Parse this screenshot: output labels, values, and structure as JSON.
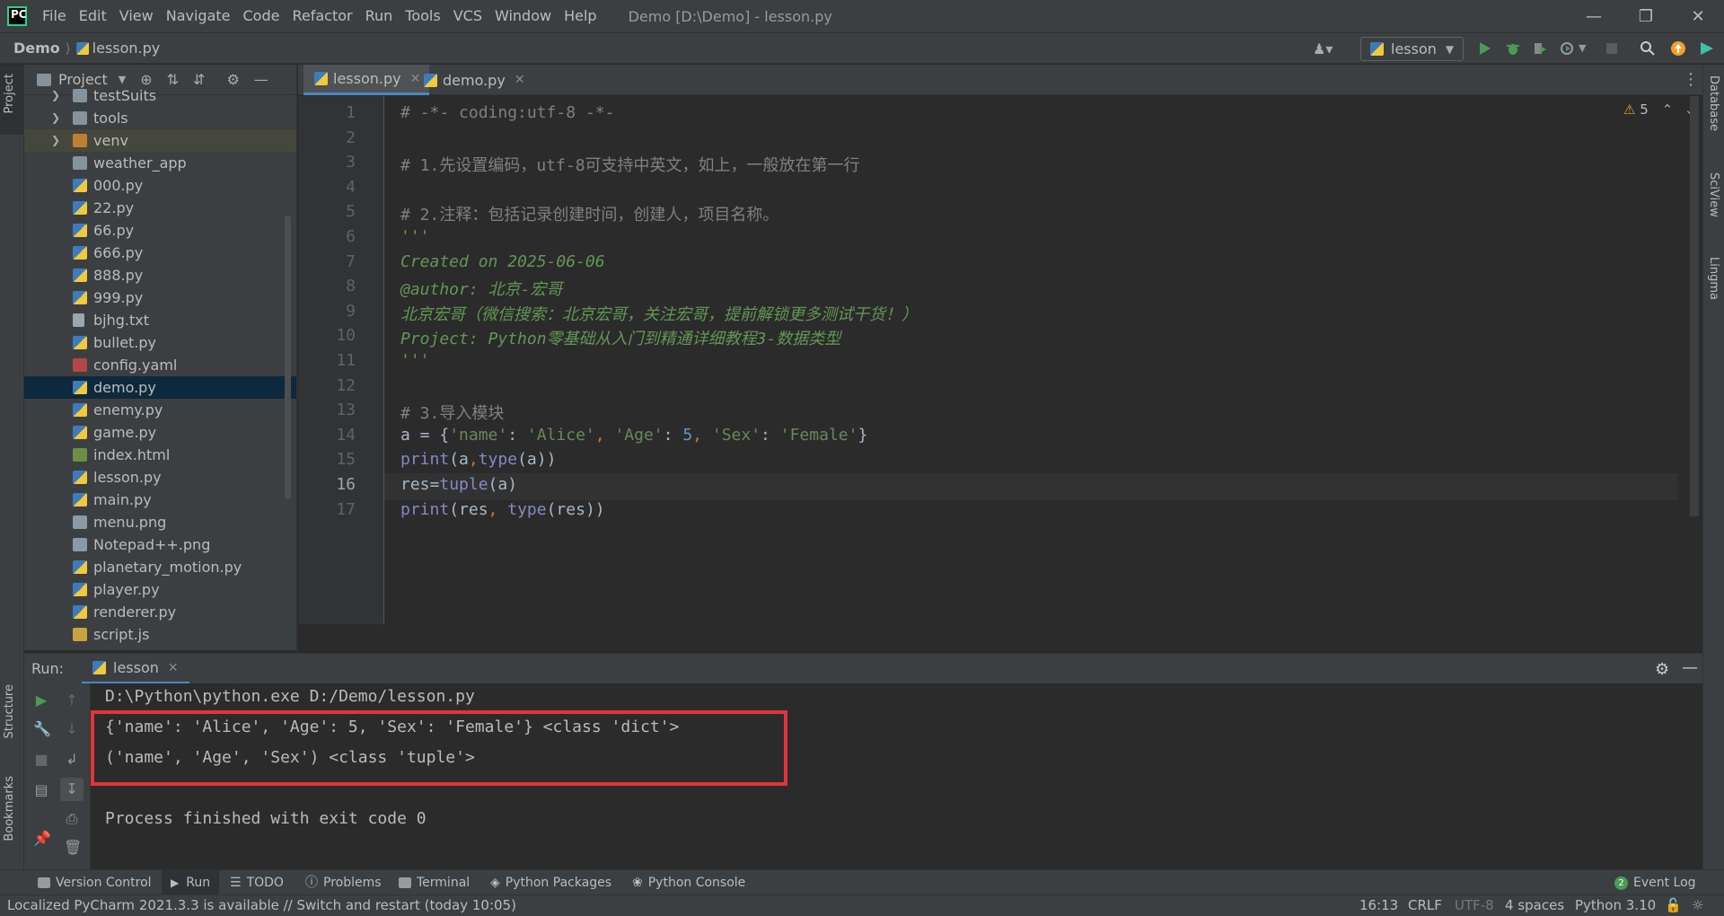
{
  "menu": [
    "File",
    "Edit",
    "View",
    "Navigate",
    "Code",
    "Refactor",
    "Run",
    "Tools",
    "VCS",
    "Window",
    "Help"
  ],
  "window_title": "Demo [D:\\Demo] - lesson.py",
  "breadcrumb": {
    "project": "Demo",
    "file": "lesson.py"
  },
  "run_config": "lesson",
  "left_tabs": {
    "project": "Project",
    "structure": "Structure",
    "bookmarks": "Bookmarks"
  },
  "right_tabs": {
    "database": "Database",
    "sciview": "SciView",
    "lingma": "Lingma"
  },
  "project_panel": {
    "title": "Project",
    "items": [
      {
        "label": "testSuits",
        "type": "folder",
        "expandable": true
      },
      {
        "label": "tools",
        "type": "folder",
        "expandable": true
      },
      {
        "label": "venv",
        "type": "folder-orange",
        "expandable": true
      },
      {
        "label": "weather_app",
        "type": "folder",
        "expandable": false
      },
      {
        "label": "000.py",
        "type": "py"
      },
      {
        "label": "22.py",
        "type": "py"
      },
      {
        "label": "66.py",
        "type": "py"
      },
      {
        "label": "666.py",
        "type": "py"
      },
      {
        "label": "888.py",
        "type": "py"
      },
      {
        "label": "999.py",
        "type": "py"
      },
      {
        "label": "bjhg.txt",
        "type": "txt"
      },
      {
        "label": "bullet.py",
        "type": "py"
      },
      {
        "label": "config.yaml",
        "type": "yaml"
      },
      {
        "label": "demo.py",
        "type": "py",
        "selected": true
      },
      {
        "label": "enemy.py",
        "type": "py"
      },
      {
        "label": "game.py",
        "type": "py"
      },
      {
        "label": "index.html",
        "type": "html"
      },
      {
        "label": "lesson.py",
        "type": "py"
      },
      {
        "label": "main.py",
        "type": "py"
      },
      {
        "label": "menu.png",
        "type": "png"
      },
      {
        "label": "Notepad++.png",
        "type": "png"
      },
      {
        "label": "planetary_motion.py",
        "type": "py"
      },
      {
        "label": "player.py",
        "type": "py"
      },
      {
        "label": "renderer.py",
        "type": "py"
      },
      {
        "label": "script.js",
        "type": "js"
      }
    ]
  },
  "editor": {
    "tabs": [
      {
        "label": "lesson.py",
        "active": true
      },
      {
        "label": "demo.py",
        "active": false
      }
    ],
    "warnings": "5",
    "current_line": 16,
    "lines": [
      [
        {
          "t": "# -*- coding:utf-8 -*-",
          "c": "com"
        }
      ],
      [],
      [
        {
          "t": "# 1.先设置编码，utf-8可支持中英文，如上，一般放在第一行",
          "c": "com"
        }
      ],
      [],
      [
        {
          "t": "# 2.注释：包括记录创建时间，创建人，项目名称。",
          "c": "com"
        }
      ],
      [
        {
          "t": "'''",
          "c": "doc"
        }
      ],
      [
        {
          "t": "Created on 2025-06-06",
          "c": "doc"
        }
      ],
      [
        {
          "t": "@author: 北京-宏哥",
          "c": "doc"
        }
      ],
      [
        {
          "t": "北京宏哥（微信搜索：北京宏哥，关注宏哥，提前解锁更多测试干货！）",
          "c": "doc"
        }
      ],
      [
        {
          "t": "Project: Python零基础从入门到精通详细教程3-数据类型",
          "c": "doc"
        }
      ],
      [
        {
          "t": "'''",
          "c": "doc"
        }
      ],
      [],
      [
        {
          "t": "# 3.导入模块",
          "c": "com"
        }
      ],
      [
        {
          "t": "a = {",
          "c": ""
        },
        {
          "t": "'name'",
          "c": "str"
        },
        {
          "t": ": ",
          "c": ""
        },
        {
          "t": "'Alice'",
          "c": "str"
        },
        {
          "t": ", ",
          "c": "kw"
        },
        {
          "t": "'Age'",
          "c": "str"
        },
        {
          "t": ": ",
          "c": ""
        },
        {
          "t": "5",
          "c": "num"
        },
        {
          "t": ", ",
          "c": "kw"
        },
        {
          "t": "'Sex'",
          "c": "str"
        },
        {
          "t": ": ",
          "c": ""
        },
        {
          "t": "'Female'",
          "c": "str"
        },
        {
          "t": "}",
          "c": ""
        }
      ],
      [
        {
          "t": "print",
          "c": "bi"
        },
        {
          "t": "(a",
          "c": ""
        },
        {
          "t": ",",
          "c": "kw"
        },
        {
          "t": "type",
          "c": "bi"
        },
        {
          "t": "(a))",
          "c": ""
        }
      ],
      [
        {
          "t": "res=",
          "c": ""
        },
        {
          "t": "tuple",
          "c": "bi"
        },
        {
          "t": "(a)",
          "c": ""
        }
      ],
      [
        {
          "t": "print",
          "c": "bi"
        },
        {
          "t": "(res",
          "c": ""
        },
        {
          "t": ", ",
          "c": "kw"
        },
        {
          "t": "type",
          "c": "bi"
        },
        {
          "t": "(res))",
          "c": ""
        }
      ]
    ]
  },
  "run": {
    "label": "Run:",
    "tab": "lesson",
    "output": [
      "D:\\Python\\python.exe D:/Demo/lesson.py",
      "{'name': 'Alice', 'Age': 5, 'Sex': 'Female'} <class 'dict'>",
      "('name', 'Age', 'Sex') <class 'tuple'>",
      "",
      "Process finished with exit code 0"
    ]
  },
  "bottom_tabs": [
    "Version Control",
    "Run",
    "TODO",
    "Problems",
    "Terminal",
    "Python Packages",
    "Python Console"
  ],
  "event_log": {
    "count": "2",
    "label": "Event Log"
  },
  "status": {
    "message": "Localized PyCharm 2021.3.3 is available // Switch and restart (today 10:05)",
    "position": "16:13",
    "line_sep": "CRLF",
    "encoding": "UTF-8",
    "indent": "4 spaces",
    "interpreter": "Python 3.10"
  },
  "colors": {
    "accent": "#4a88c7",
    "highlight_box": "#e0363a",
    "run_green": "#499c54"
  }
}
